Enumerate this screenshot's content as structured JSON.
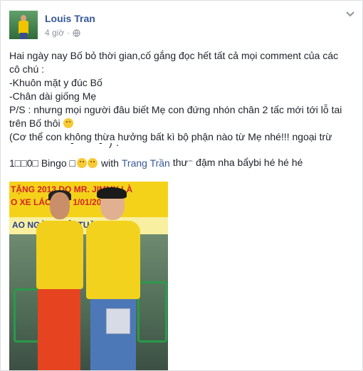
{
  "post": {
    "author": "Louis Tran",
    "timestamp": "4 giờ",
    "separator": "·",
    "lines": [
      "Hai ngày nay Bố bỏ thời gian,cố gắng đọc hết tất cả mọi comment của các",
      "cô chú :",
      "-Khuôn mặt y đúc Bố",
      "-Chân dài giống Mẹ",
      "P/S : nhưng mọi người đâu biết Mẹ con đứng nhón chân 2 tấc mới tới lỗ tai",
      "trên Bố thôi",
      "(Cơ thể con không thừa hưởng bất kì bộ phận nào từ Mẹ nhé!!! ngoại trừ"
    ],
    "tag_line": {
      "prefix": "1□□0□ Bingo □",
      "with": "with",
      "tagged": "Trang Trần",
      "suffix": "thư⁻ đậm nha bẩybi hé hé hé"
    }
  },
  "icons": {
    "globe": "globe-icon",
    "chevron": "chevron-down-icon",
    "emoji": "smiley-emoji-icon"
  },
  "photo": {
    "banner_line1": "TẶNG 2013 DO MR. JIMMY LÀ",
    "banner_line2": "O XE LÁC HAY 1/01/2013",
    "banner_line3": "AO NGÀY CUỘI TUẦN"
  },
  "colors": {
    "link": "#365899",
    "text": "#1d2129",
    "meta": "#90949c"
  }
}
